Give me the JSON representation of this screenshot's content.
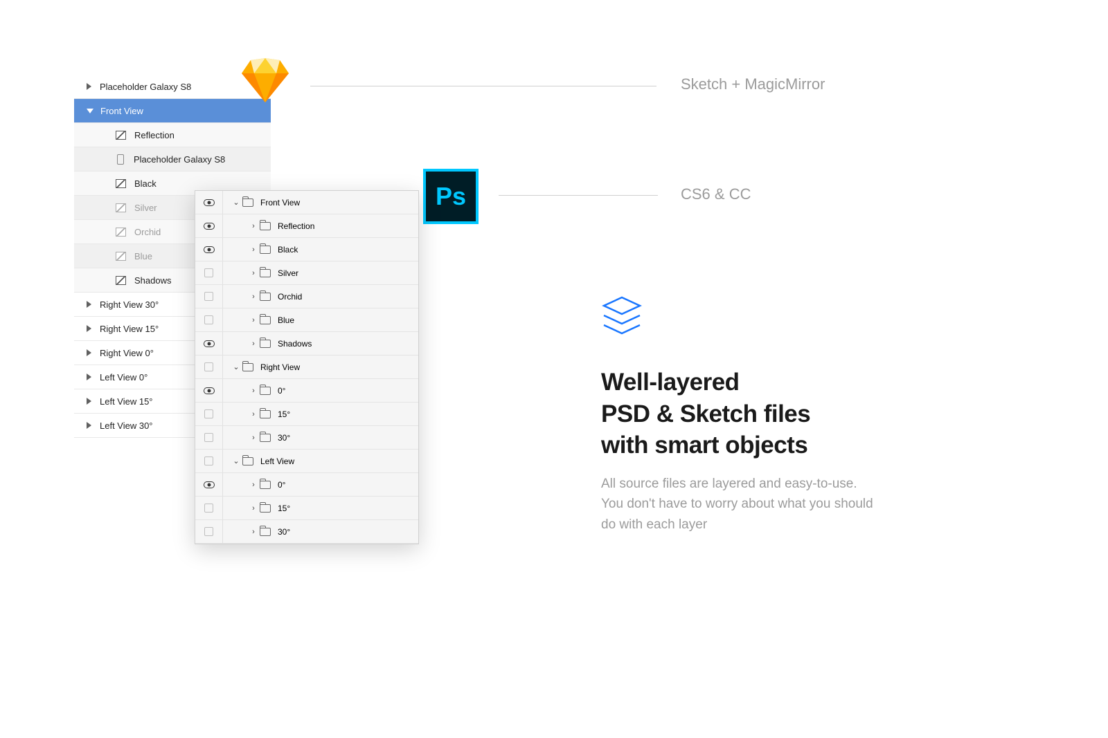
{
  "captions": {
    "sketch": "Sketch + MagicMirror",
    "photoshop": "CS6 & CC"
  },
  "ps_icon_text": "Ps",
  "headline": {
    "line1": "Well-layered",
    "line2": "PSD & Sketch files",
    "line3": "with smart objects"
  },
  "body": "All source files are layered and easy-to-use. You don't have to worry about what you should do with each layer",
  "sketch_panel": {
    "rows": [
      {
        "label": "Placeholder Galaxy S8"
      },
      {
        "label": "Front View"
      },
      {
        "label": "Reflection"
      },
      {
        "label": "Placeholder Galaxy S8"
      },
      {
        "label": "Black"
      },
      {
        "label": "Silver"
      },
      {
        "label": "Orchid"
      },
      {
        "label": "Blue"
      },
      {
        "label": "Shadows"
      },
      {
        "label": "Right View 30°"
      },
      {
        "label": "Right View 15°"
      },
      {
        "label": "Right View 0°"
      },
      {
        "label": "Left View 0°"
      },
      {
        "label": "Left View 15°"
      },
      {
        "label": "Left View 30°"
      }
    ]
  },
  "ps_panel": {
    "rows": [
      {
        "label": "Front View"
      },
      {
        "label": "Reflection"
      },
      {
        "label": "Black"
      },
      {
        "label": "Silver"
      },
      {
        "label": "Orchid"
      },
      {
        "label": "Blue"
      },
      {
        "label": "Shadows"
      },
      {
        "label": "Right View"
      },
      {
        "label": "0°"
      },
      {
        "label": "15°"
      },
      {
        "label": "30°"
      },
      {
        "label": "Left View"
      },
      {
        "label": "0°"
      },
      {
        "label": "15°"
      },
      {
        "label": "30°"
      }
    ]
  }
}
